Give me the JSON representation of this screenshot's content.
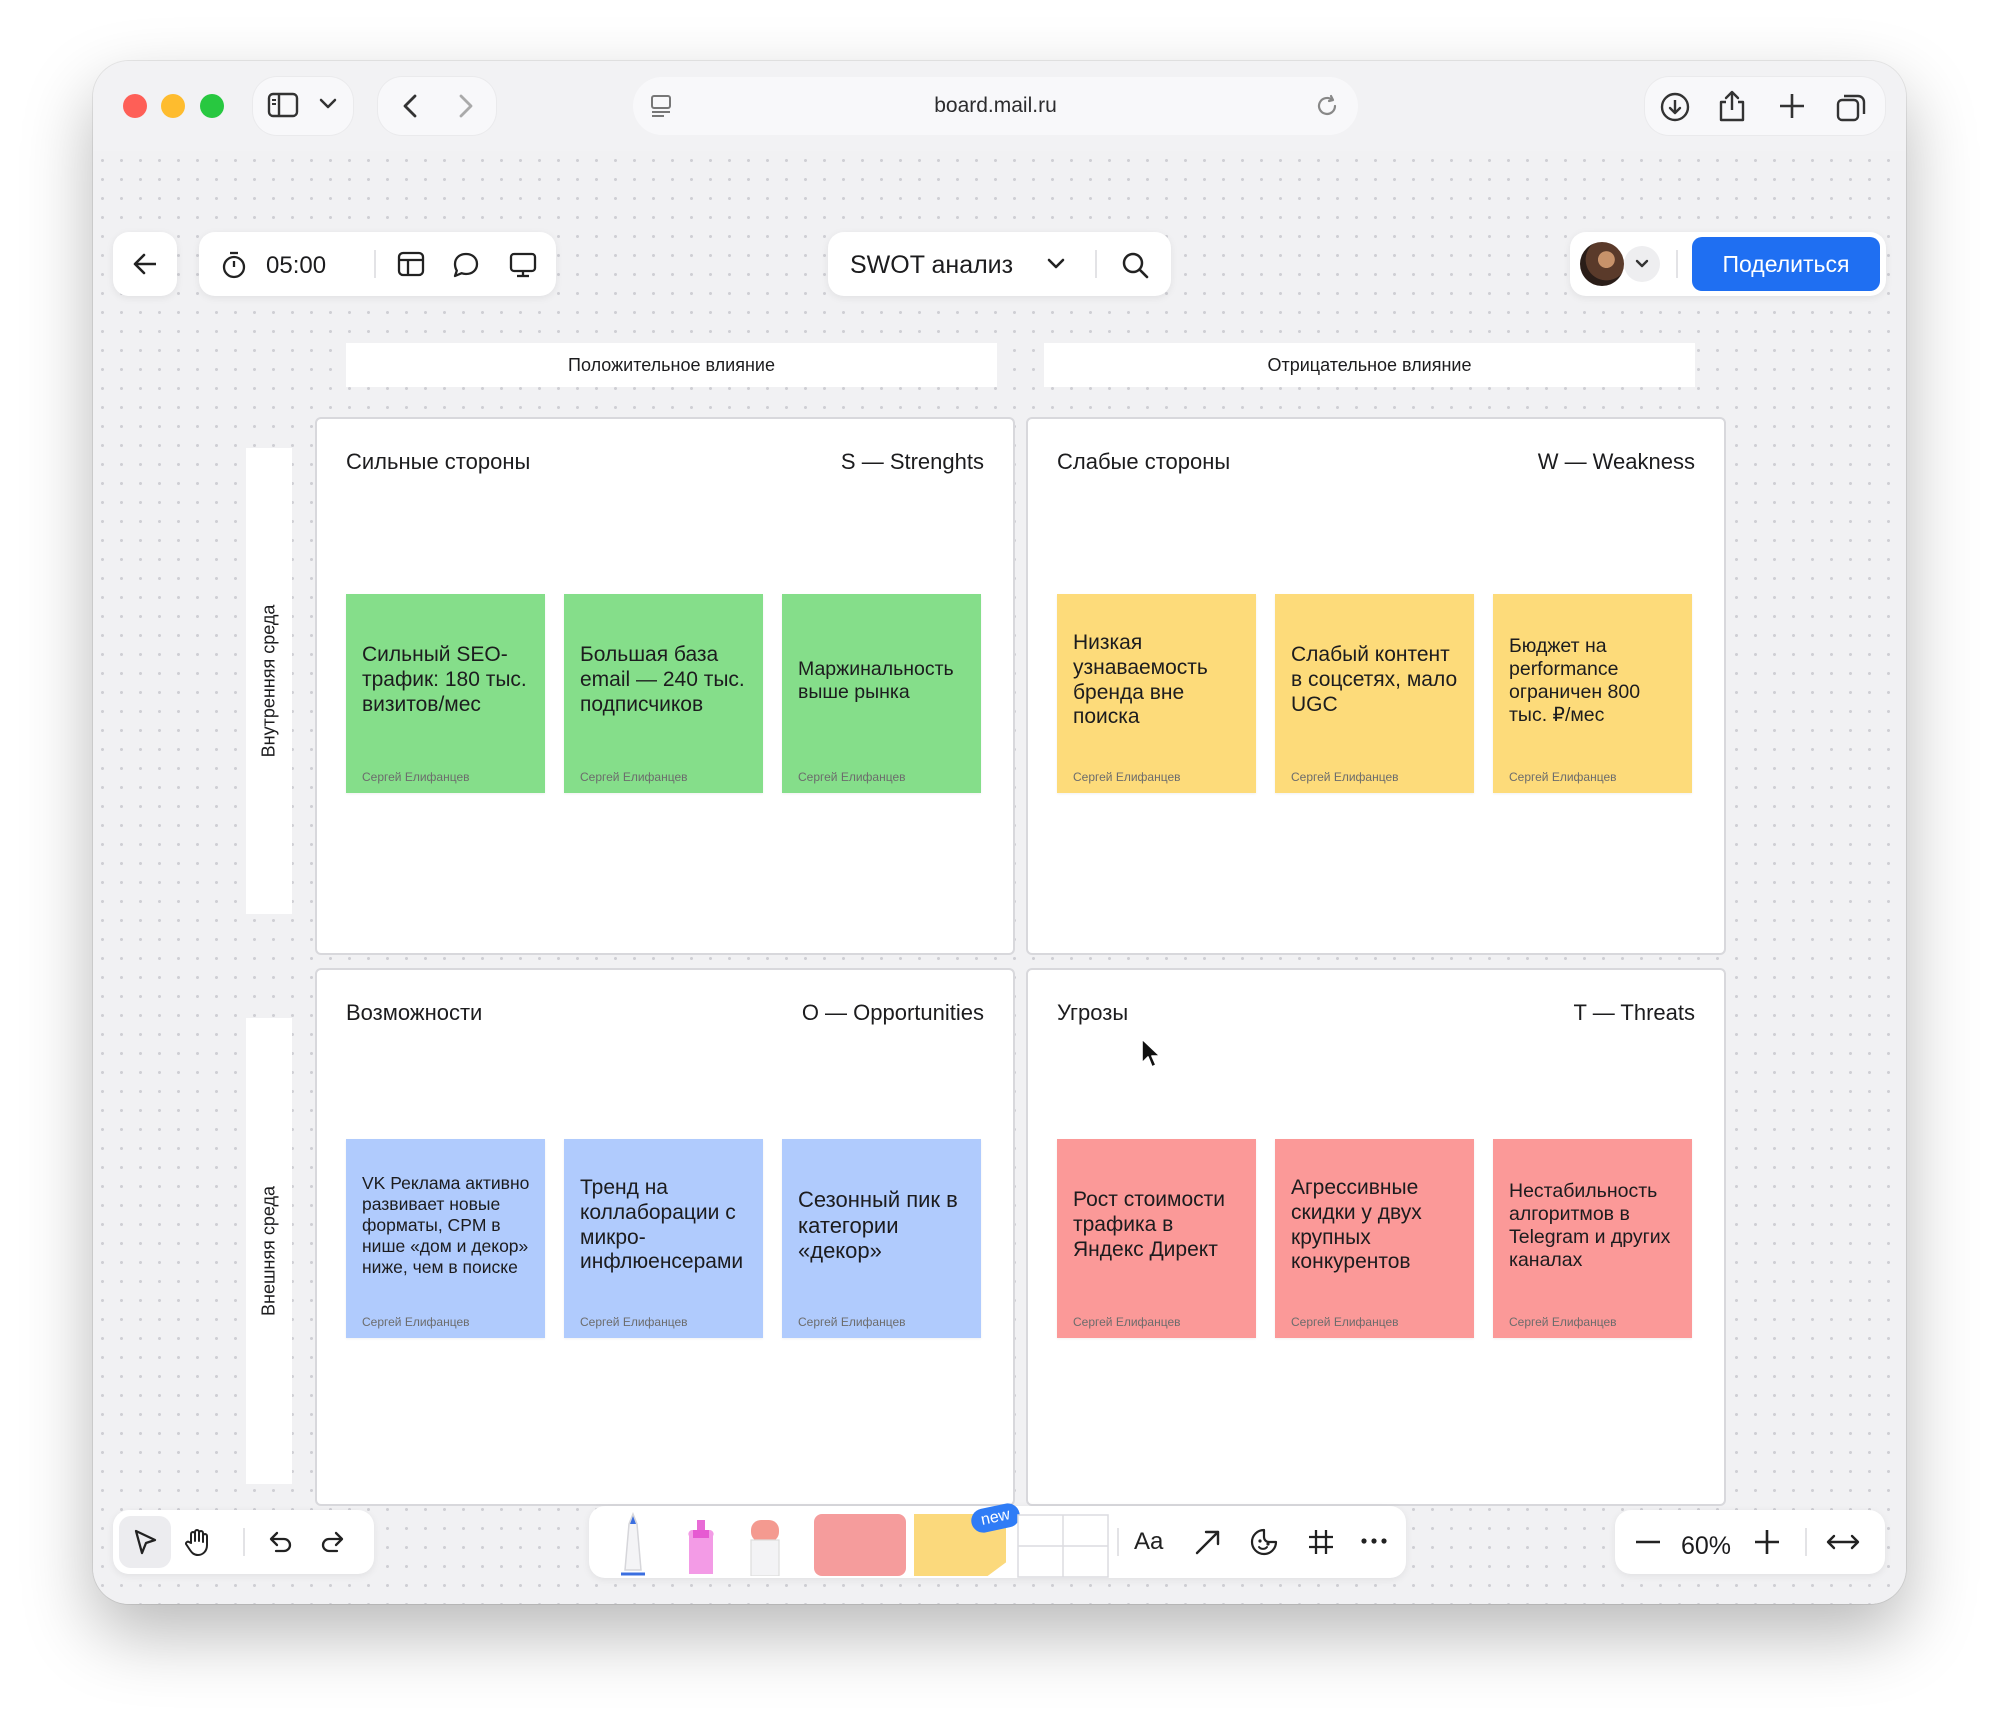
{
  "browser": {
    "url": "board.mail.ru"
  },
  "toolbar": {
    "timer": "05:00",
    "board_title": "SWOT анализ",
    "share_label": "Поделиться"
  },
  "board": {
    "columns": [
      "Положительное влияние",
      "Отрицательное влияние"
    ],
    "rows": [
      "Внутренняя среда",
      "Внешняя среда"
    ],
    "quadrants": [
      {
        "title_ru": "Сильные стороны",
        "title_en": "S — Strenghts",
        "color": "#85de8a",
        "notes": [
          {
            "text": "Сильный SEO-трафик: 180 тыс. визитов/мес",
            "author": "Сергей Елифанцев"
          },
          {
            "text": "Большая база email — 240 тыс. подписчиков",
            "author": "Сергей Елифанцев"
          },
          {
            "text": "Маржинальность выше рынка",
            "author": "Сергей Елифанцев"
          }
        ]
      },
      {
        "title_ru": "Слабые стороны",
        "title_en": "W — Weakness",
        "color": "#fddb7a",
        "notes": [
          {
            "text": "Низкая узнаваемость бренда вне поиска",
            "author": "Сергей Елифанцев"
          },
          {
            "text": "Слабый контент в соцсетях, мало UGC",
            "author": "Сергей Елифанцев"
          },
          {
            "text": "Бюджет на performance ограничен 800 тыс. ₽/мес",
            "author": "Сергей Елифанцев"
          }
        ]
      },
      {
        "title_ru": "Возможности",
        "title_en": "O — Opportunities",
        "color": "#b0cbfd",
        "notes": [
          {
            "text": "VK Реклама активно развивает новые форматы, CPM в нише «дом и декор» ниже, чем в поиске",
            "author": "Сергей Елифанцев"
          },
          {
            "text": "Тренд на коллаборации с микро-инфлюенсерами",
            "author": "Сергей Елифанцев"
          },
          {
            "text": "Сезонный пик в категории «декор»",
            "author": "Сергей Елифанцев"
          }
        ]
      },
      {
        "title_ru": "Угрозы",
        "title_en": "T — Threats",
        "color": "#fb9998",
        "notes": [
          {
            "text": "Рост стоимости трафика в Яндекс Директ",
            "author": "Сергей Елифанцев"
          },
          {
            "text": "Агрессивные скидки у двух крупных конкурентов",
            "author": "Сергей Елифанцев"
          },
          {
            "text": "Нестабильность алгоритмов в Telegram и других каналах",
            "author": "Сергей Елифанцев"
          }
        ]
      }
    ]
  },
  "bottom": {
    "text_tool": "Aa",
    "new_badge": "new",
    "zoom": "60%"
  }
}
